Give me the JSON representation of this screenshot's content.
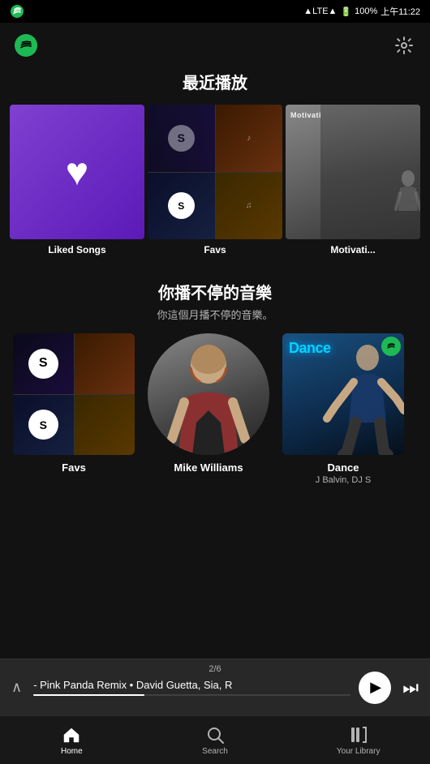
{
  "statusBar": {
    "carrier": "",
    "network": "LTE",
    "battery": "100%",
    "time": "上午11:22"
  },
  "header": {
    "settingsLabel": "⚙"
  },
  "recentPlays": {
    "sectionTitle": "最近播放",
    "items": [
      {
        "id": "liked-songs",
        "label": "Liked Songs",
        "type": "liked"
      },
      {
        "id": "favs",
        "label": "Favs",
        "type": "collage"
      },
      {
        "id": "motivation",
        "label": "Motivati...",
        "type": "motivation"
      }
    ]
  },
  "nonStop": {
    "sectionTitle": "你播不停的音樂",
    "sectionSubtitle": "你這個月播不停的音樂。",
    "items": [
      {
        "id": "favs2",
        "name": "Favs",
        "subname": "",
        "type": "collage"
      },
      {
        "id": "mike-williams",
        "name": "Mike Williams",
        "subname": "",
        "type": "artist"
      },
      {
        "id": "dance",
        "name": "Dance",
        "subname": "J Balvin, DJ S",
        "type": "dance"
      }
    ]
  },
  "nowPlaying": {
    "trackText": "- Pink Panda Remix • David Guetta, Sia, R",
    "pageIndicator": "2/6",
    "progress": 35
  },
  "bottomNav": {
    "items": [
      {
        "id": "home",
        "label": "Home",
        "icon": "🏠",
        "active": true
      },
      {
        "id": "search",
        "label": "Search",
        "icon": "🔍",
        "active": false
      },
      {
        "id": "library",
        "label": "Your Library",
        "icon": "📚",
        "active": false
      }
    ]
  }
}
